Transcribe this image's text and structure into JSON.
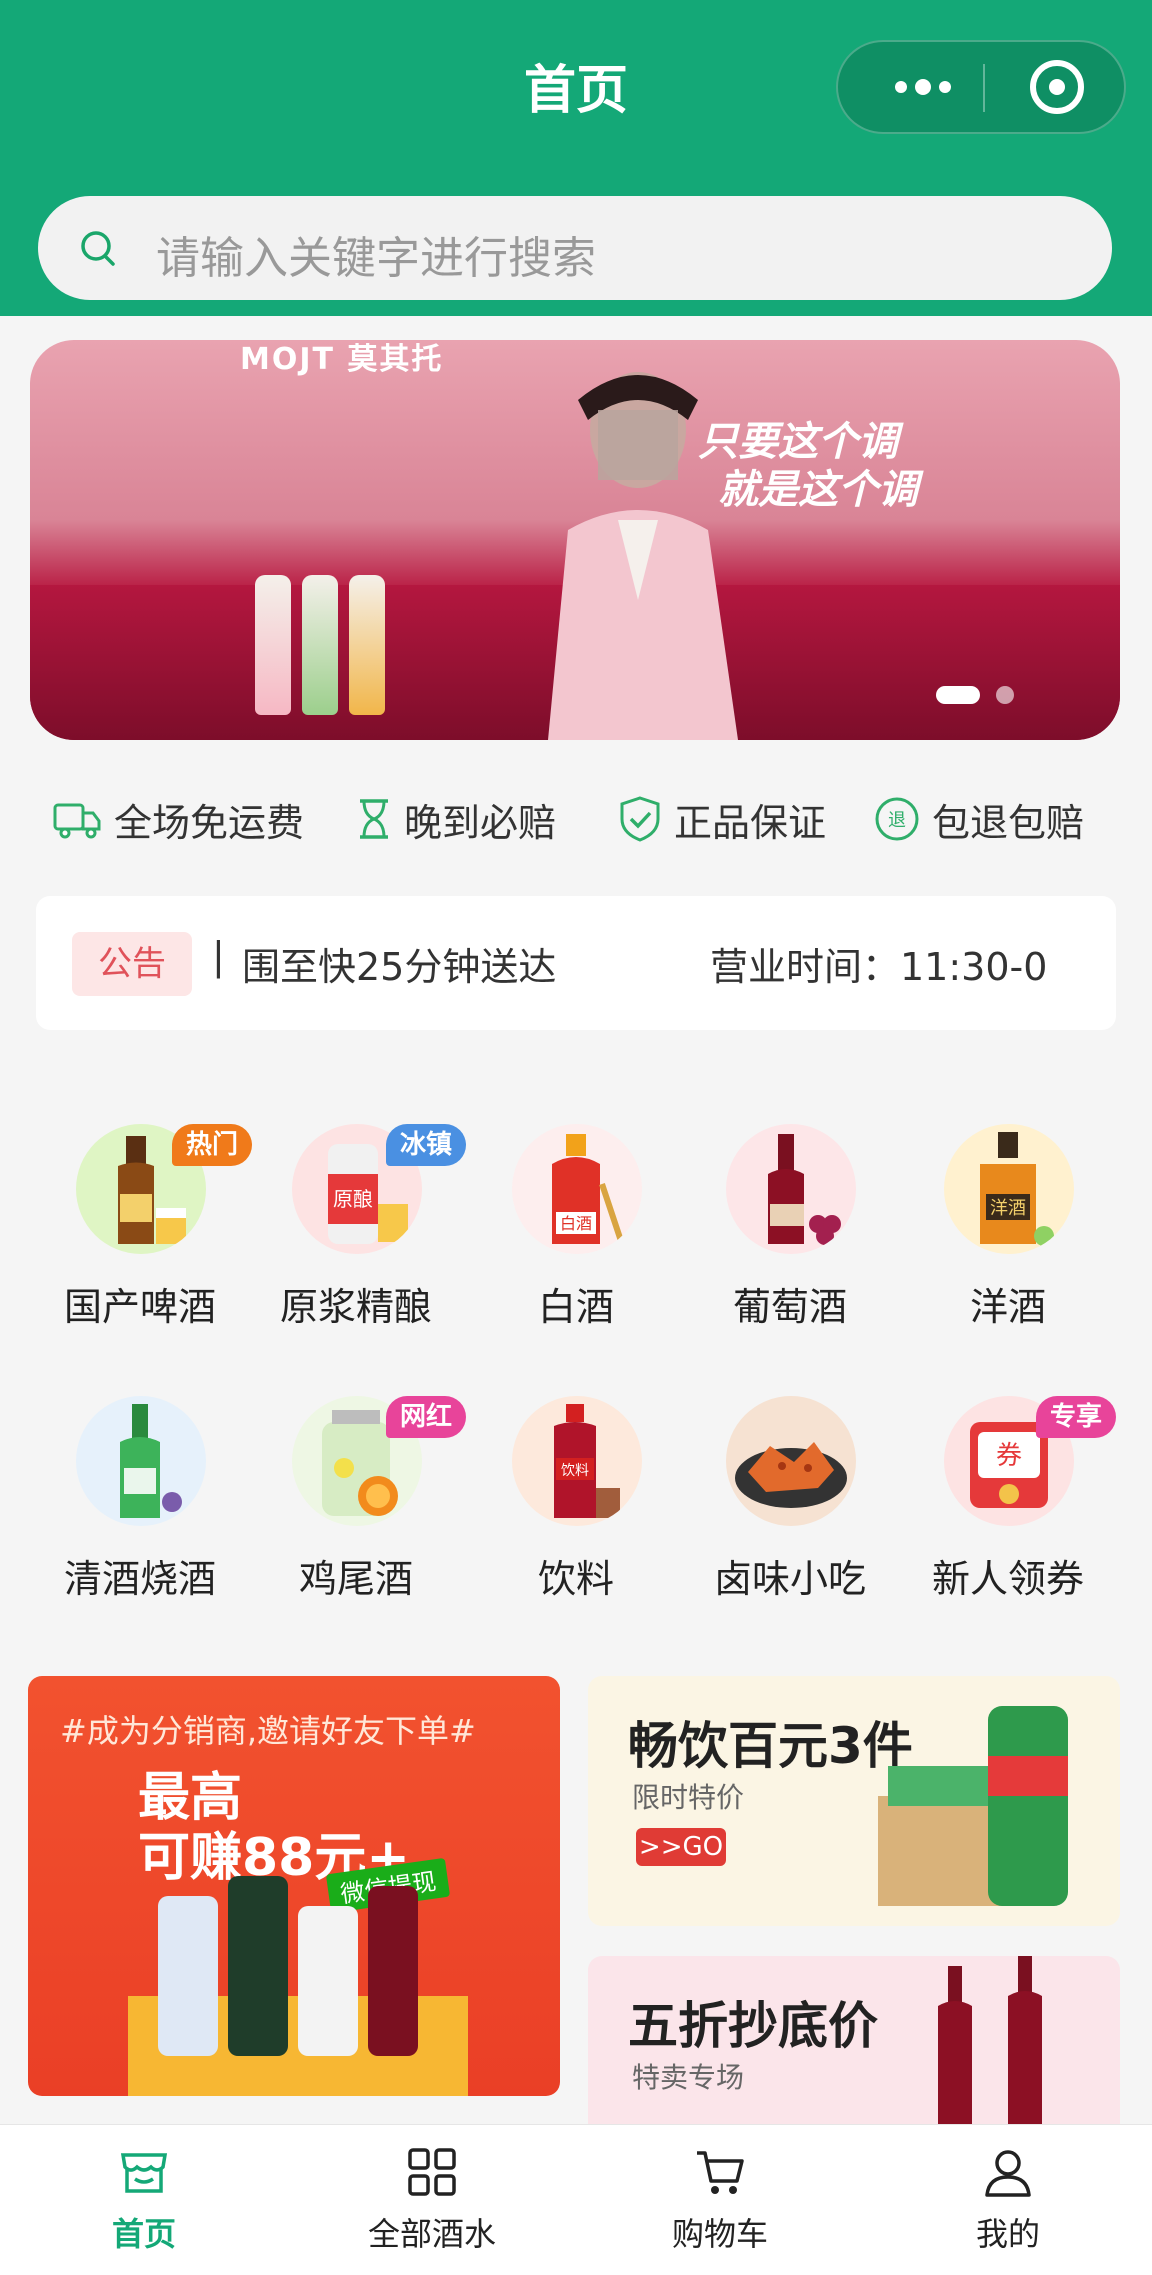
{
  "header": {
    "title": "首页",
    "capsule_menu_icon": "more-dots-icon",
    "capsule_close_icon": "target-icon"
  },
  "search": {
    "placeholder": "请输入关键字进行搜索"
  },
  "banner": {
    "brand": "MOJT 莫其托",
    "slogan_line1": "只要这个调",
    "slogan_line2": "就是这个调"
  },
  "features": [
    {
      "label": "全场免运费",
      "icon": "truck-icon"
    },
    {
      "label": "晚到必赔",
      "icon": "hourglass-icon"
    },
    {
      "label": "正品保证",
      "icon": "shield-check-icon"
    },
    {
      "label": "包退包赔",
      "icon": "refund-icon"
    }
  ],
  "notice": {
    "badge": "公告",
    "separator": "|",
    "text": "围至快25分钟送达",
    "hours": "营业时间：11:30-0"
  },
  "categories": [
    {
      "label": "国产啤酒",
      "tag": "热门"
    },
    {
      "label": "原浆精酿",
      "tag": "冰镇"
    },
    {
      "label": "白酒",
      "tag": ""
    },
    {
      "label": "葡萄酒",
      "tag": ""
    },
    {
      "label": "洋酒",
      "tag": ""
    },
    {
      "label": "清酒烧酒",
      "tag": ""
    },
    {
      "label": "鸡尾酒",
      "tag": "网红"
    },
    {
      "label": "饮料",
      "tag": ""
    },
    {
      "label": "卤味小吃",
      "tag": ""
    },
    {
      "label": "新人领券",
      "tag": "专享"
    }
  ],
  "promo_left": {
    "top_text": "#成为分销商,邀请好友下单#",
    "main_line1": "最高",
    "main_line2": "可赚88元+",
    "wechat_badge": "微信提现"
  },
  "promo_right_top": {
    "title": "畅饮百元3件",
    "subtitle": "限时特价",
    "go": ">>GO"
  },
  "promo_right_bottom": {
    "title": "五折抄底价",
    "subtitle": "特卖专场"
  },
  "tabbar": [
    {
      "label": "首页",
      "icon": "store-icon",
      "active": true
    },
    {
      "label": "全部酒水",
      "icon": "grid-icon",
      "active": false
    },
    {
      "label": "购物车",
      "icon": "cart-icon",
      "active": false
    },
    {
      "label": "我的",
      "icon": "user-icon",
      "active": false
    }
  ],
  "colors": {
    "brand_green": "#14a877",
    "notice_red": "#e0525a",
    "tag_orange": "#f07a1a",
    "tag_blue": "#4a90e2",
    "tag_pink": "#e8449a"
  }
}
